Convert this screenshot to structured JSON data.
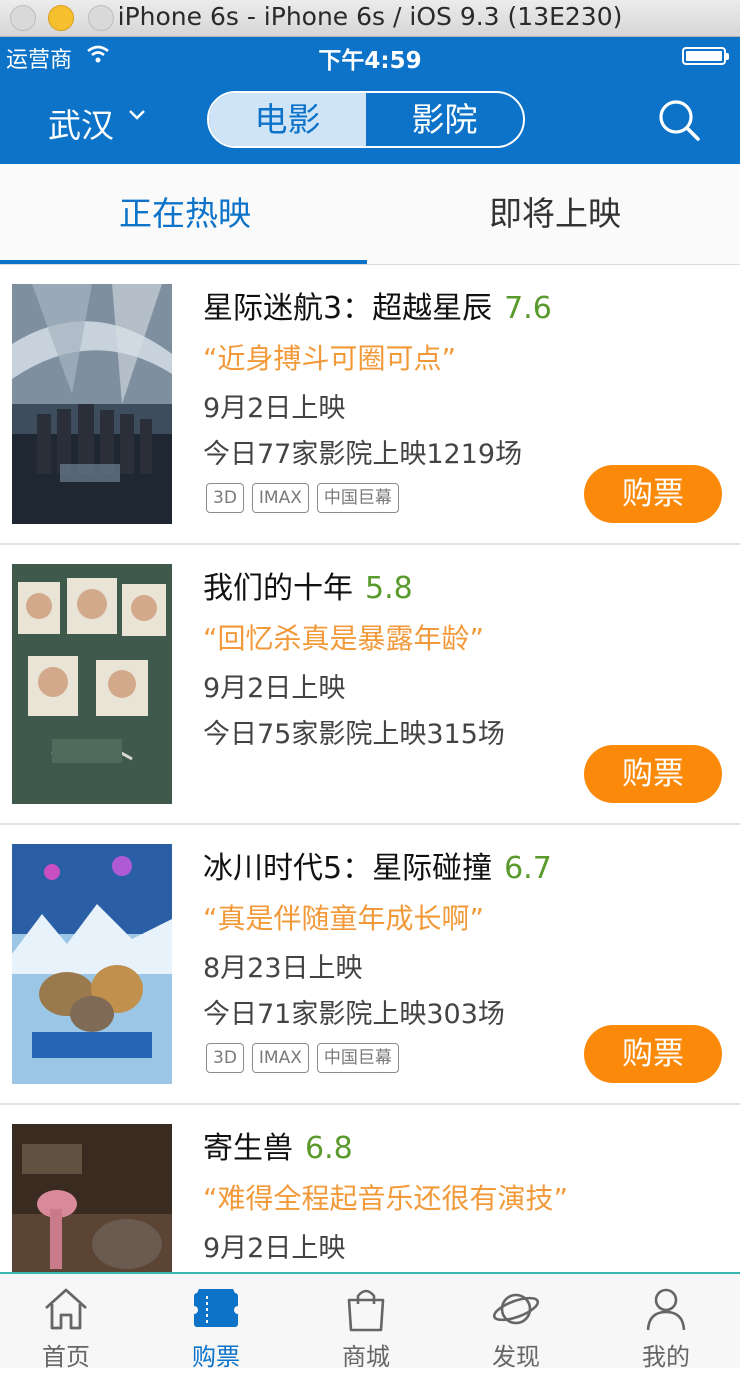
{
  "window": {
    "title": "iPhone 6s - iPhone 6s / iOS 9.3 (13E230)",
    "buttons": [
      "#ee5f57",
      "#f5bf2e",
      "#c8c8c8"
    ]
  },
  "status_bar": {
    "carrier": "运营商",
    "time": "下午4:59"
  },
  "header": {
    "city": "武汉",
    "segments": [
      "电影",
      "影院"
    ],
    "active_segment": 0
  },
  "tabs": {
    "items": [
      "正在热映",
      "即将上映"
    ],
    "active": 0
  },
  "movies": [
    {
      "title": "星际迷航3：超越星辰",
      "score": "7.6",
      "quote": "“近身搏斗可圈可点”",
      "release": "9月2日上映",
      "shows": "今日77家影院上映1219场",
      "tags": [
        "3D",
        "IMAX",
        "中国巨幕"
      ],
      "buy": "购票"
    },
    {
      "title": "我们的十年",
      "score": "5.8",
      "quote": "“回忆杀真是暴露年龄”",
      "release": "9月2日上映",
      "shows": "今日75家影院上映315场",
      "tags": [],
      "buy": "购票"
    },
    {
      "title": "冰川时代5：星际碰撞",
      "score": "6.7",
      "quote": "“真是伴随童年成长啊”",
      "release": "8月23日上映",
      "shows": "今日71家影院上映303场",
      "tags": [
        "3D",
        "IMAX",
        "中国巨幕"
      ],
      "buy": "购票"
    },
    {
      "title": "寄生兽",
      "score": "6.8",
      "quote": "“难得全程起音乐还很有演技”",
      "release": "9月2日上映"
    }
  ],
  "tabbar": {
    "items": [
      {
        "label": "首页",
        "icon": "home-icon"
      },
      {
        "label": "购票",
        "icon": "ticket-icon"
      },
      {
        "label": "商城",
        "icon": "shopping-bag-icon"
      },
      {
        "label": "发现",
        "icon": "planet-icon"
      },
      {
        "label": "我的",
        "icon": "person-icon"
      }
    ],
    "active": 1
  },
  "colors": {
    "brand_blue": "#0d73c9",
    "buy_orange": "#fb8a0b",
    "score_green": "#5a9a2d",
    "quote_orange": "#f29a3a"
  }
}
